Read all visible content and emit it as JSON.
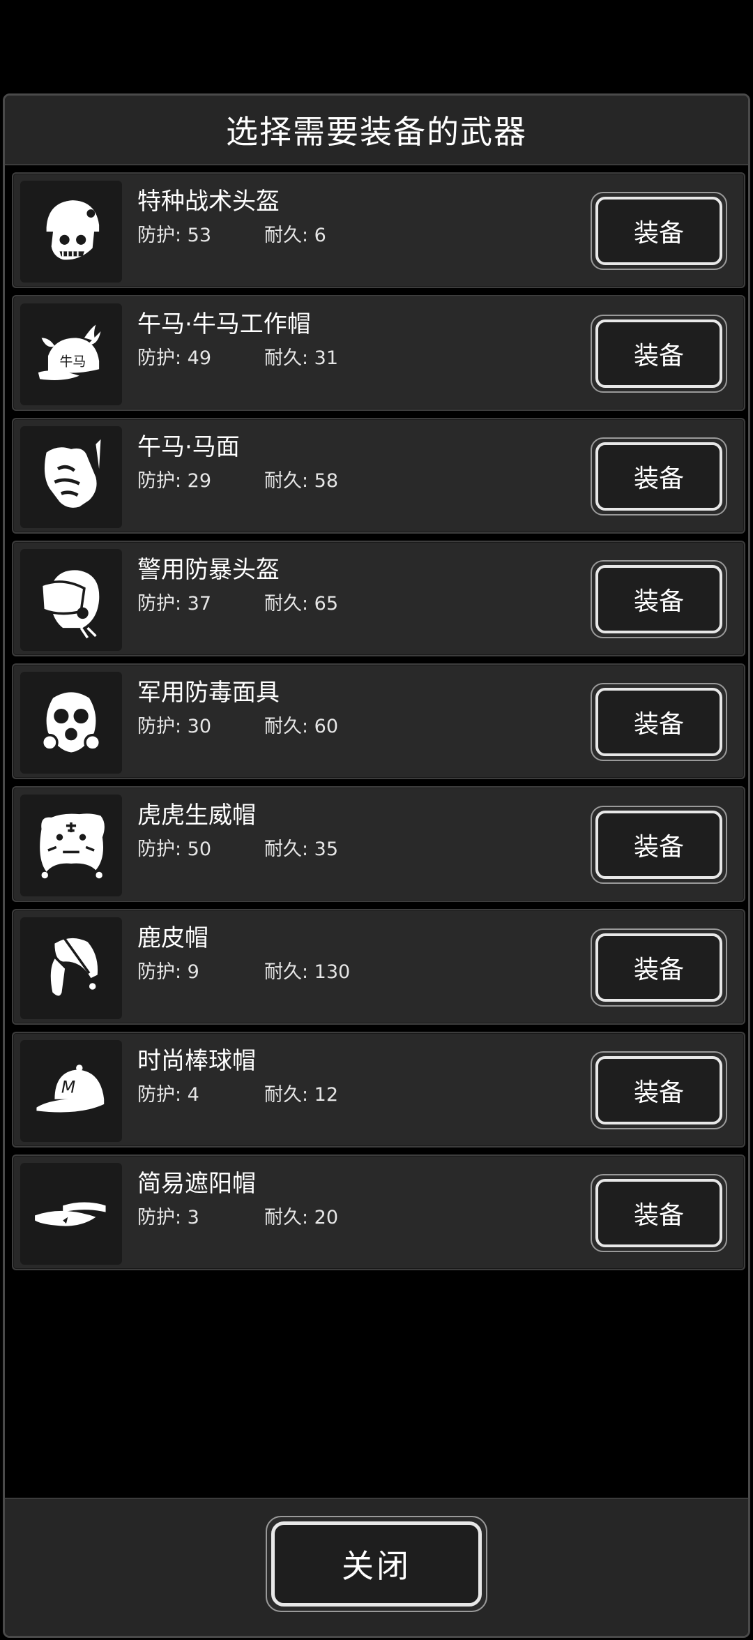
{
  "dialog": {
    "title": "选择需要装备的武器",
    "close_label": "关闭"
  },
  "items": [
    {
      "name": "特种战术头盔",
      "protect": "防护: 53",
      "durability": "耐久: 6",
      "button": "装备",
      "icon": "tactical-helmet-icon"
    },
    {
      "name": "午马·牛马工作帽",
      "protect": "防护: 49",
      "durability": "耐久: 31",
      "button": "装备",
      "icon": "ox-horse-work-cap-icon"
    },
    {
      "name": "午马·马面",
      "protect": "防护: 29",
      "durability": "耐久: 58",
      "button": "装备",
      "icon": "horse-mask-icon"
    },
    {
      "name": "警用防暴头盔",
      "protect": "防护: 37",
      "durability": "耐久: 65",
      "button": "装备",
      "icon": "riot-helmet-icon"
    },
    {
      "name": "军用防毒面具",
      "protect": "防护: 30",
      "durability": "耐久: 60",
      "button": "装备",
      "icon": "gas-mask-icon"
    },
    {
      "name": "虎虎生威帽",
      "protect": "防护: 50",
      "durability": "耐久: 35",
      "button": "装备",
      "icon": "tiger-hat-icon"
    },
    {
      "name": "鹿皮帽",
      "protect": "防护: 9",
      "durability": "耐久: 130",
      "button": "装备",
      "icon": "deerskin-hat-icon"
    },
    {
      "name": "时尚棒球帽",
      "protect": "防护: 4",
      "durability": "耐久: 12",
      "button": "装备",
      "icon": "baseball-cap-icon"
    },
    {
      "name": "简易遮阳帽",
      "protect": "防护: 3",
      "durability": "耐久: 20",
      "button": "装备",
      "icon": "sun-visor-icon"
    }
  ]
}
